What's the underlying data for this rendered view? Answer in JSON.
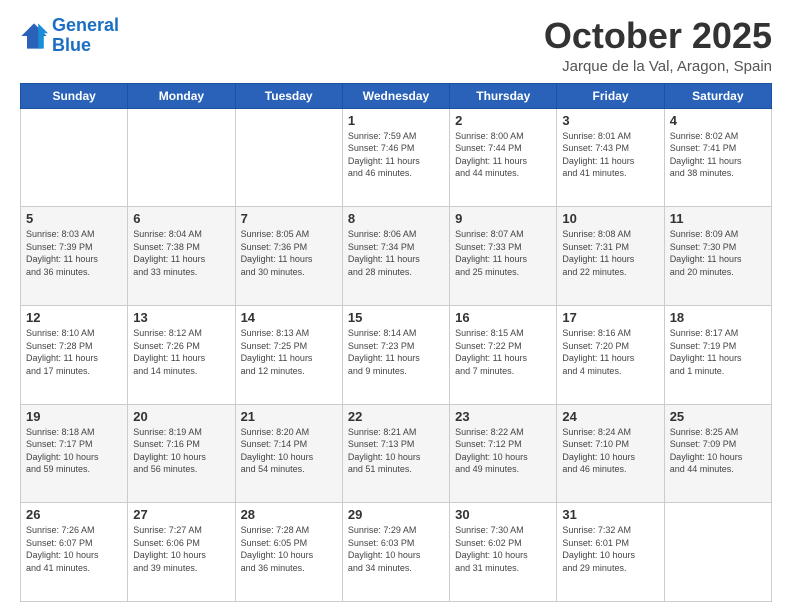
{
  "logo": {
    "line1": "General",
    "line2": "Blue"
  },
  "header": {
    "month": "October 2025",
    "location": "Jarque de la Val, Aragon, Spain"
  },
  "days_of_week": [
    "Sunday",
    "Monday",
    "Tuesday",
    "Wednesday",
    "Thursday",
    "Friday",
    "Saturday"
  ],
  "weeks": [
    [
      {
        "day": "",
        "info": ""
      },
      {
        "day": "",
        "info": ""
      },
      {
        "day": "",
        "info": ""
      },
      {
        "day": "1",
        "info": "Sunrise: 7:59 AM\nSunset: 7:46 PM\nDaylight: 11 hours\nand 46 minutes."
      },
      {
        "day": "2",
        "info": "Sunrise: 8:00 AM\nSunset: 7:44 PM\nDaylight: 11 hours\nand 44 minutes."
      },
      {
        "day": "3",
        "info": "Sunrise: 8:01 AM\nSunset: 7:43 PM\nDaylight: 11 hours\nand 41 minutes."
      },
      {
        "day": "4",
        "info": "Sunrise: 8:02 AM\nSunset: 7:41 PM\nDaylight: 11 hours\nand 38 minutes."
      }
    ],
    [
      {
        "day": "5",
        "info": "Sunrise: 8:03 AM\nSunset: 7:39 PM\nDaylight: 11 hours\nand 36 minutes."
      },
      {
        "day": "6",
        "info": "Sunrise: 8:04 AM\nSunset: 7:38 PM\nDaylight: 11 hours\nand 33 minutes."
      },
      {
        "day": "7",
        "info": "Sunrise: 8:05 AM\nSunset: 7:36 PM\nDaylight: 11 hours\nand 30 minutes."
      },
      {
        "day": "8",
        "info": "Sunrise: 8:06 AM\nSunset: 7:34 PM\nDaylight: 11 hours\nand 28 minutes."
      },
      {
        "day": "9",
        "info": "Sunrise: 8:07 AM\nSunset: 7:33 PM\nDaylight: 11 hours\nand 25 minutes."
      },
      {
        "day": "10",
        "info": "Sunrise: 8:08 AM\nSunset: 7:31 PM\nDaylight: 11 hours\nand 22 minutes."
      },
      {
        "day": "11",
        "info": "Sunrise: 8:09 AM\nSunset: 7:30 PM\nDaylight: 11 hours\nand 20 minutes."
      }
    ],
    [
      {
        "day": "12",
        "info": "Sunrise: 8:10 AM\nSunset: 7:28 PM\nDaylight: 11 hours\nand 17 minutes."
      },
      {
        "day": "13",
        "info": "Sunrise: 8:12 AM\nSunset: 7:26 PM\nDaylight: 11 hours\nand 14 minutes."
      },
      {
        "day": "14",
        "info": "Sunrise: 8:13 AM\nSunset: 7:25 PM\nDaylight: 11 hours\nand 12 minutes."
      },
      {
        "day": "15",
        "info": "Sunrise: 8:14 AM\nSunset: 7:23 PM\nDaylight: 11 hours\nand 9 minutes."
      },
      {
        "day": "16",
        "info": "Sunrise: 8:15 AM\nSunset: 7:22 PM\nDaylight: 11 hours\nand 7 minutes."
      },
      {
        "day": "17",
        "info": "Sunrise: 8:16 AM\nSunset: 7:20 PM\nDaylight: 11 hours\nand 4 minutes."
      },
      {
        "day": "18",
        "info": "Sunrise: 8:17 AM\nSunset: 7:19 PM\nDaylight: 11 hours\nand 1 minute."
      }
    ],
    [
      {
        "day": "19",
        "info": "Sunrise: 8:18 AM\nSunset: 7:17 PM\nDaylight: 10 hours\nand 59 minutes."
      },
      {
        "day": "20",
        "info": "Sunrise: 8:19 AM\nSunset: 7:16 PM\nDaylight: 10 hours\nand 56 minutes."
      },
      {
        "day": "21",
        "info": "Sunrise: 8:20 AM\nSunset: 7:14 PM\nDaylight: 10 hours\nand 54 minutes."
      },
      {
        "day": "22",
        "info": "Sunrise: 8:21 AM\nSunset: 7:13 PM\nDaylight: 10 hours\nand 51 minutes."
      },
      {
        "day": "23",
        "info": "Sunrise: 8:22 AM\nSunset: 7:12 PM\nDaylight: 10 hours\nand 49 minutes."
      },
      {
        "day": "24",
        "info": "Sunrise: 8:24 AM\nSunset: 7:10 PM\nDaylight: 10 hours\nand 46 minutes."
      },
      {
        "day": "25",
        "info": "Sunrise: 8:25 AM\nSunset: 7:09 PM\nDaylight: 10 hours\nand 44 minutes."
      }
    ],
    [
      {
        "day": "26",
        "info": "Sunrise: 7:26 AM\nSunset: 6:07 PM\nDaylight: 10 hours\nand 41 minutes."
      },
      {
        "day": "27",
        "info": "Sunrise: 7:27 AM\nSunset: 6:06 PM\nDaylight: 10 hours\nand 39 minutes."
      },
      {
        "day": "28",
        "info": "Sunrise: 7:28 AM\nSunset: 6:05 PM\nDaylight: 10 hours\nand 36 minutes."
      },
      {
        "day": "29",
        "info": "Sunrise: 7:29 AM\nSunset: 6:03 PM\nDaylight: 10 hours\nand 34 minutes."
      },
      {
        "day": "30",
        "info": "Sunrise: 7:30 AM\nSunset: 6:02 PM\nDaylight: 10 hours\nand 31 minutes."
      },
      {
        "day": "31",
        "info": "Sunrise: 7:32 AM\nSunset: 6:01 PM\nDaylight: 10 hours\nand 29 minutes."
      },
      {
        "day": "",
        "info": ""
      }
    ]
  ]
}
